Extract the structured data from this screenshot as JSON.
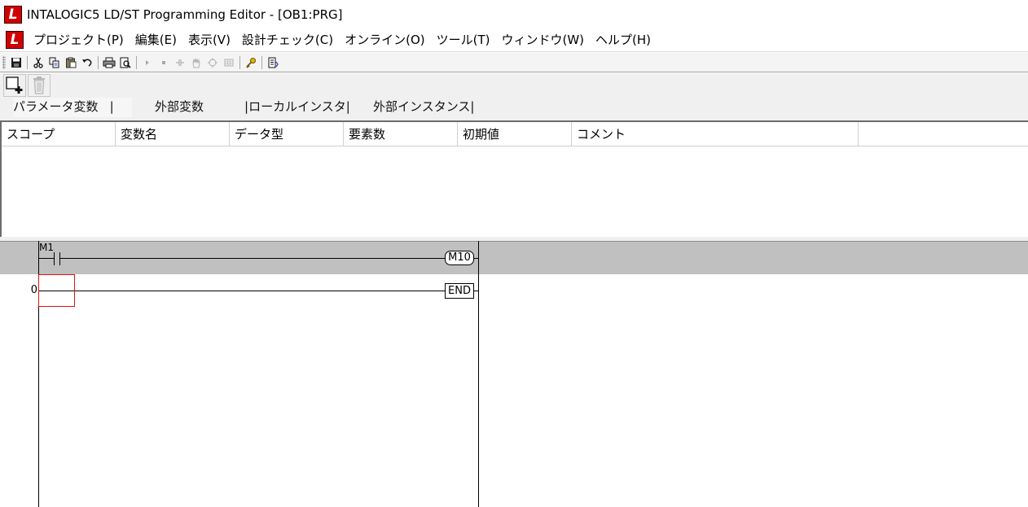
{
  "window": {
    "title": "INTALOGIC5 LD/ST Programming Editor - [OB1:PRG]",
    "logo_letter": "L"
  },
  "menu": {
    "items": [
      {
        "id": "project",
        "label": "プロジェクト(P)"
      },
      {
        "id": "edit",
        "label": "編集(E)"
      },
      {
        "id": "view",
        "label": "表示(V)"
      },
      {
        "id": "design-check",
        "label": "設計チェック(C)"
      },
      {
        "id": "online",
        "label": "オンライン(O)"
      },
      {
        "id": "tool",
        "label": "ツール(T)"
      },
      {
        "id": "window",
        "label": "ウィンドウ(W)"
      },
      {
        "id": "help",
        "label": "ヘルプ(H)"
      }
    ]
  },
  "toolbar": {
    "icons": [
      "save-icon",
      "cut-icon",
      "copy-icon",
      "paste-icon",
      "undo-icon",
      "print-icon",
      "print-preview-icon",
      "run-icon",
      "stop-icon",
      "step-icon",
      "hand-icon",
      "monitor-icon",
      "grid-icon",
      "key-icon",
      "list-icon"
    ]
  },
  "var_toolbar": {
    "add_icon": "add-variable-icon",
    "delete_icon": "trash-icon"
  },
  "tabs": [
    {
      "label": "パラメータ変数",
      "active": true
    },
    {
      "label": "外部変数",
      "active": false
    },
    {
      "label": "ローカルインスタ",
      "active": false
    },
    {
      "label": "外部インスタンス",
      "active": false
    }
  ],
  "var_table": {
    "columns": [
      "スコープ",
      "変数名",
      "データ型",
      "要素数",
      "初期値",
      "コメント"
    ]
  },
  "ladder": {
    "rung0": {
      "contact_label": "M1",
      "coil_label": "M10"
    },
    "rung1": {
      "step": "0",
      "end_label": "END"
    }
  },
  "colors": {
    "logo_red": "#d10000",
    "cursor_red": "#d11111",
    "rung_band": "#c0c0c0"
  }
}
